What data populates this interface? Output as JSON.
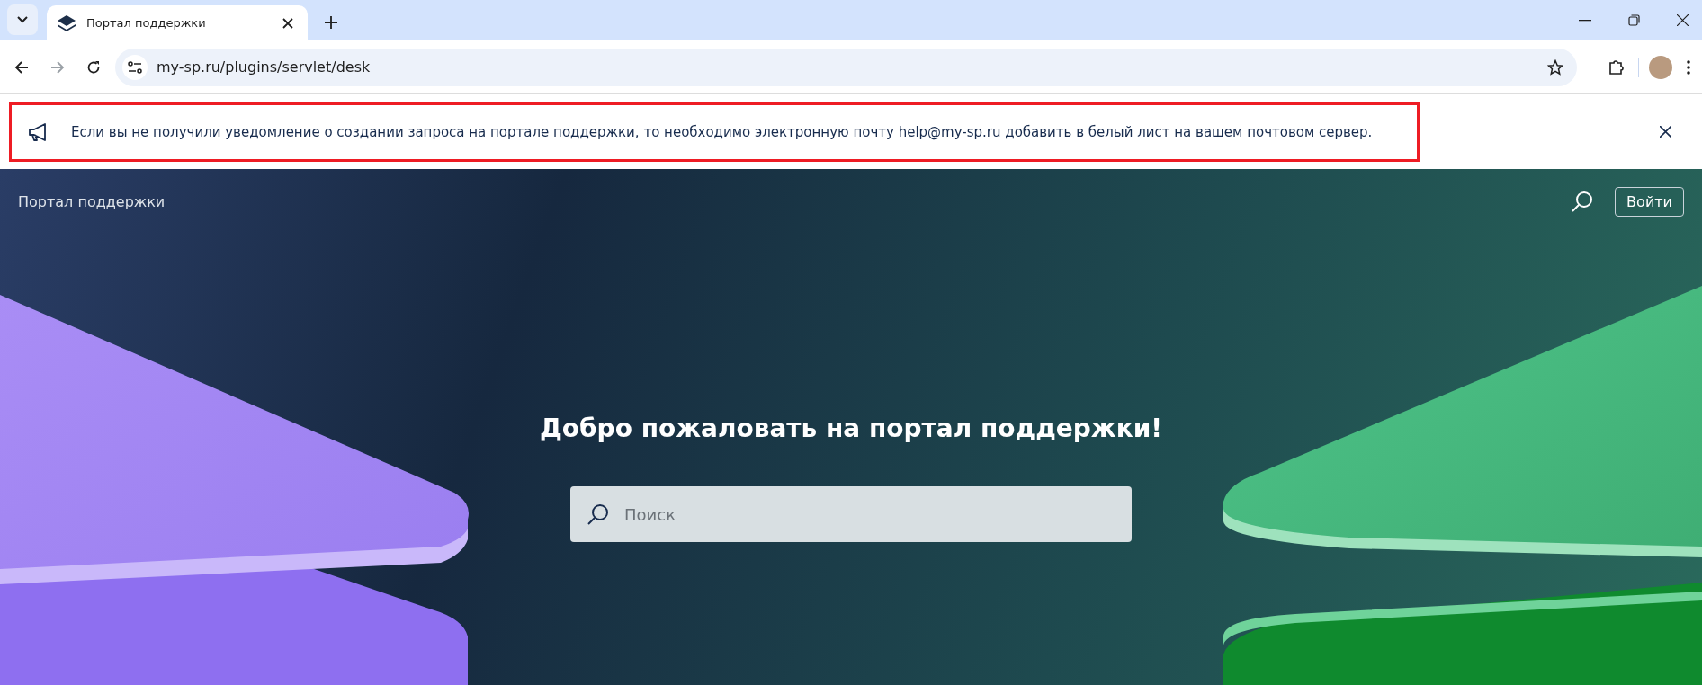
{
  "browser": {
    "tab": {
      "title": "Портал поддержки",
      "selected": true
    },
    "address": "my-sp.ru/plugins/servlet/desk"
  },
  "banner": {
    "text": "Если вы не получили уведомление о создании запроса на портале поддержки, то необходимо электронную почту help@my-sp.ru добавить в белый лист на вашем почтовом сервер."
  },
  "header": {
    "title": "Портал поддержки",
    "login": "Войти"
  },
  "hero": {
    "heading": "Добро пожаловать на портал поддержки!",
    "search": {
      "placeholder": "Поиск"
    }
  }
}
